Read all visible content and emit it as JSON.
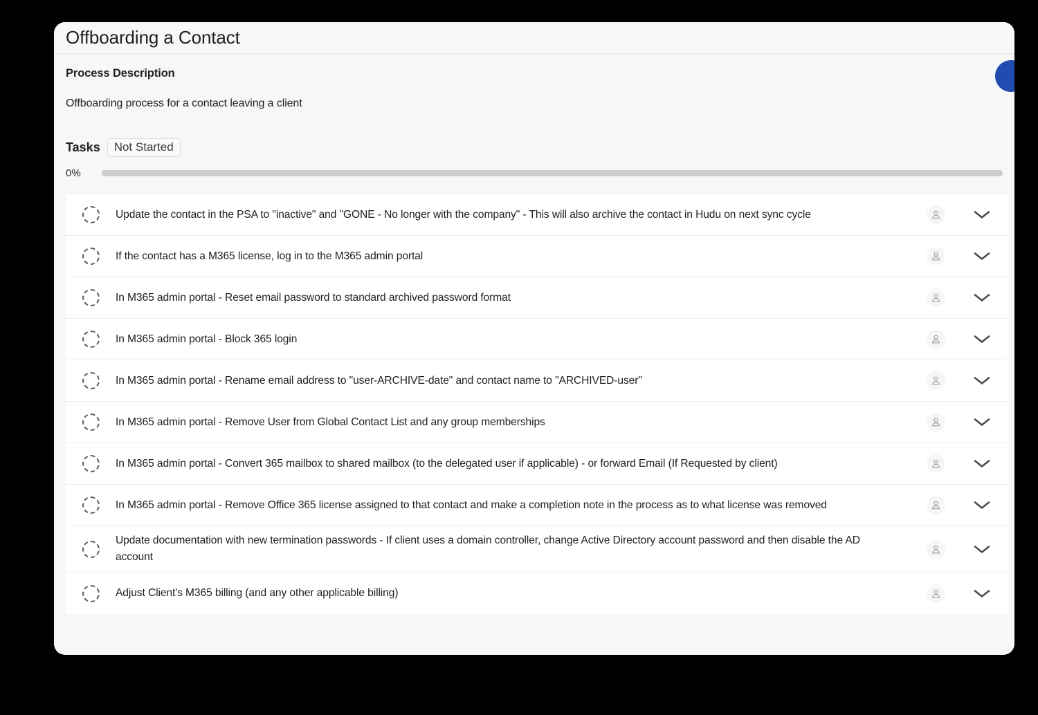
{
  "window": {
    "title": "Offboarding a Contact"
  },
  "fab": {
    "name": "action-button",
    "color": "#1f4cae"
  },
  "process": {
    "section_heading": "Process Description",
    "description": "Offboarding process for a contact leaving a client"
  },
  "tasks_section": {
    "label": "Tasks",
    "status": "Not Started",
    "progress_percent_label": "0%",
    "progress_percent_value": 0
  },
  "icons": {
    "checkbox": "dashed-circle-icon",
    "assignee": "user-icon",
    "expand": "chevron-down-icon"
  },
  "tasks": [
    {
      "text": "Update the contact in the PSA to \"inactive\" and \"GONE - No longer with the company\" - This will also archive the contact in Hudu on next sync cycle"
    },
    {
      "text": "If the contact has a M365 license, log in to the M365 admin portal"
    },
    {
      "text": "In M365 admin portal - Reset email password to standard archived password format"
    },
    {
      "text": "In M365 admin portal - Block 365 login"
    },
    {
      "text": "In M365 admin portal - Rename email address to \"user-ARCHIVE-date\" and contact name to \"ARCHIVED-user\""
    },
    {
      "text": "In M365 admin portal - Remove User from Global Contact List and any group memberships"
    },
    {
      "text": "In M365 admin portal - Convert 365 mailbox to shared mailbox (to the delegated user if applicable) - or forward Email (If Requested by client)"
    },
    {
      "text": "In M365 admin portal - Remove Office 365 license assigned to that contact and make a completion note in the process as to what license was removed"
    },
    {
      "text": "Update documentation with new termination passwords - If client uses a domain controller, change Active Directory account password and then disable the AD account"
    },
    {
      "text": "Adjust Client's M365 billing (and any other applicable billing)"
    }
  ]
}
